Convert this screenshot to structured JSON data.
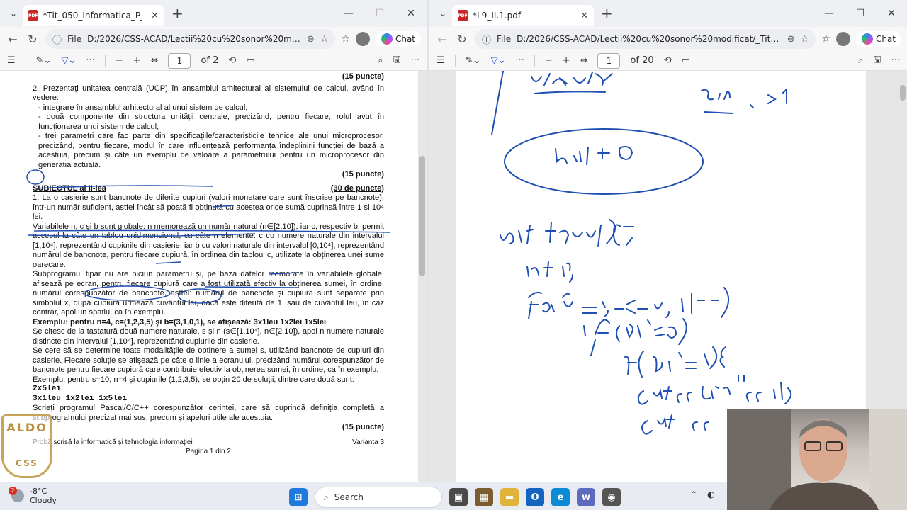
{
  "left_window": {
    "tab_title": "*Tit_050_Informatica_P_2025_var_0",
    "address_label": "File",
    "url": "D:/2026/CSS-ACAD/Lectii%20cu%20sonor%20modifi...",
    "copilot_label": "Chat",
    "page_current": "1",
    "page_total": "of 2"
  },
  "right_window": {
    "tab_title": "*L9_II.1.pdf",
    "address_label": "File",
    "url": "D:/2026/CSS-ACAD/Lectii%20cu%20sonor%20modificat/_Titulariz...",
    "copilot_label": "Chat",
    "page_current": "1",
    "page_total": "of 20"
  },
  "document": {
    "top_points": "(15 puncte)",
    "item2": {
      "intro": "2. Prezentați unitatea centrală (UCP) în ansamblul arhitectural al sistemului de calcul, având în vedere:",
      "bullet1": "- integrare în ansamblul arhitectural al unui sistem de calcul;",
      "bullet2": "- două componente din structura unității centrale, precizând, pentru fiecare, rolul avut în funcționarea unui sistem de calcul;",
      "bullet3": "- trei parametri care fac parte din specificațiile/caracteristicile tehnice ale unui microprocesor, precizând, pentru fiecare, modul în care influențează performanța îndeplinirii funcției de bază a acestuia, precum și câte un exemplu de valoare a parametrului pentru un microprocesor din generația actuală.",
      "points": "(15 puncte)"
    },
    "section_title": "SUBIECTUL al II-lea",
    "section_points": "(30 de puncte)",
    "p1": "1. La o casierie sunt bancnote de diferite cupiuri (valori monetare care sunt înscrise pe bancnote), într-un număr suficient, astfel încât să poată fi obținută cu acestea orice sumă cuprinsă între 1 și 10⁴ lei.",
    "p2": "Variabilele n, c și b sunt globale: n memorează un număr natural (n∈[2,10]), iar c, respectiv b, permit accesul la câte un tablou unidimensional, cu câte n elemente: c cu numere naturale din intervalul [1,10⁴], reprezentând cupiurile din casierie, iar b cu valori naturale din intervalul [0,10⁴], reprezentând numărul de bancnote, pentru fiecare cupiură, în ordinea din tabloul c, utilizate la obținerea unei sume oarecare.",
    "p3": "Subprogramul tipar nu are niciun parametru și, pe baza datelor memorate în variabilele globale, afișează pe ecran, pentru fiecare cupiură care a fost utilizată efectiv la obținerea sumei, în ordine, numărul corespunzător de bancnote, astfel: numărul de bancnote și cupiura sunt separate prin simbolul x, după cupiură urmează cuvântul lei, dacă este diferită de 1, sau de cuvântul leu, în caz contrar, apoi un spațiu, ca în exemplu.",
    "p4": "Exemplu: pentru n=4, c=(1,2,3,5) și b=(3,1,0,1), se afișează: 3x1leu 1x2lei 1x5lei",
    "p5": "Se citesc de la tastatură două numere naturale, s și n (s∈[1,10⁴], n∈[2,10]), apoi n numere naturale distincte din intervalul [1,10⁴], reprezentând cupiurile din casierie.",
    "p6": "Se cere să se determine toate modalitățile de obținere a sumei s, utilizând bancnote de cupiuri din casierie. Fiecare soluție se afișează pe câte o linie a ecranului, precizând numărul corespunzător de bancnote pentru fiecare cupiură care contribuie efectiv la obținerea sumei, în ordine, ca în exemplu.",
    "p7": "Exemplu: pentru s=10, n=4 și cupiurile (1,2,3,5), se obțin 20 de soluții, dintre care două sunt:",
    "sol1": "2x5lei",
    "sol2": "3x1leu 1x2lei 1x5lei",
    "p8": "Scrieți programul Pascal/C/C++ corespunzător cerinței, care să cuprindă definiția completă a subprogramului precizat mai sus, precum și apeluri utile ale acestuia.",
    "points_end": "(15 puncte)",
    "footer_left": "Probă scrisă la informatică și tehnologia informației",
    "footer_right": "Varianta 3",
    "footer_page": "Pagina 1 din 2"
  },
  "logo": {
    "top": "ALDO",
    "bottom": "CSS"
  },
  "taskbar": {
    "weather_temp": "-8°C",
    "weather_desc": "Cloudy",
    "weather_badge": "2",
    "search_label": "Search"
  },
  "colors": {
    "ink": "#1f4fb0",
    "logo_gold": "#c8a35a",
    "pdf_red": "#c62828"
  }
}
